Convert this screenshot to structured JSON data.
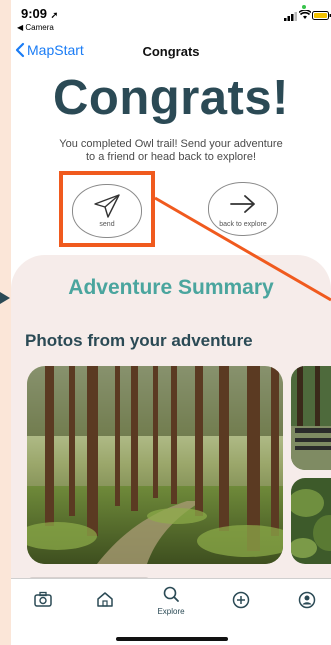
{
  "status": {
    "time": "9:09",
    "back_app": "◀ Camera"
  },
  "nav": {
    "back_label": "MapStart",
    "title": "Congrats"
  },
  "hero": {
    "title": "Congrats!",
    "subtitle": "You completed Owl trail! Send your adventure to a friend or head back to explore!"
  },
  "actions": {
    "send_label": "send",
    "explore_label": "back to explore"
  },
  "summary": {
    "title": "Adventure Summary",
    "photos_title": "Photos from your adventure"
  },
  "tabbar": {
    "explore_label": "Explore",
    "icons": [
      "camera-icon",
      "home-icon",
      "search-icon",
      "add-icon",
      "profile-icon"
    ]
  },
  "colors": {
    "accent": "#2b4a55",
    "teal": "#4aa59e",
    "link": "#1a7cf5",
    "highlight": "#f05a1e",
    "background": "#fbe6d8"
  }
}
